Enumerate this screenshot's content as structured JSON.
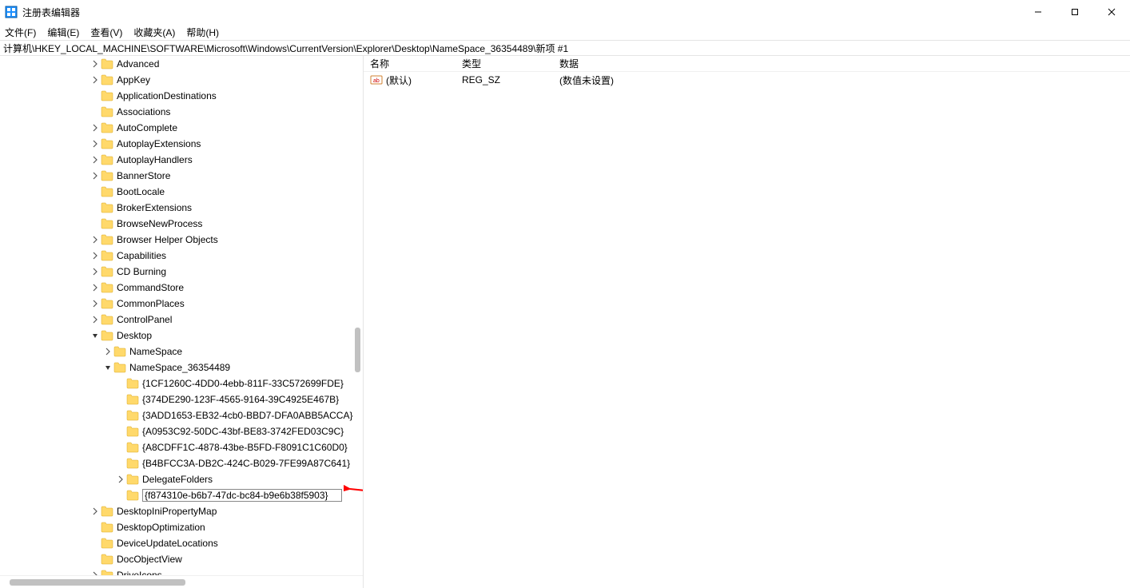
{
  "title": "注册表编辑器",
  "menu": {
    "file": "文件(F)",
    "edit": "编辑(E)",
    "view": "查看(V)",
    "fav": "收藏夹(A)",
    "help": "帮助(H)"
  },
  "address": "计算机\\HKEY_LOCAL_MACHINE\\SOFTWARE\\Microsoft\\Windows\\CurrentVersion\\Explorer\\Desktop\\NameSpace_36354489\\新项 #1",
  "tree": [
    {
      "d": 6,
      "c": "r",
      "name": "Advanced"
    },
    {
      "d": 6,
      "c": "r",
      "name": "AppKey"
    },
    {
      "d": 6,
      "c": "",
      "name": "ApplicationDestinations"
    },
    {
      "d": 6,
      "c": "",
      "name": "Associations"
    },
    {
      "d": 6,
      "c": "r",
      "name": "AutoComplete"
    },
    {
      "d": 6,
      "c": "r",
      "name": "AutoplayExtensions"
    },
    {
      "d": 6,
      "c": "r",
      "name": "AutoplayHandlers"
    },
    {
      "d": 6,
      "c": "r",
      "name": "BannerStore"
    },
    {
      "d": 6,
      "c": "",
      "name": "BootLocale"
    },
    {
      "d": 6,
      "c": "",
      "name": "BrokerExtensions"
    },
    {
      "d": 6,
      "c": "",
      "name": "BrowseNewProcess"
    },
    {
      "d": 6,
      "c": "r",
      "name": "Browser Helper Objects"
    },
    {
      "d": 6,
      "c": "r",
      "name": "Capabilities"
    },
    {
      "d": 6,
      "c": "r",
      "name": "CD Burning"
    },
    {
      "d": 6,
      "c": "r",
      "name": "CommandStore"
    },
    {
      "d": 6,
      "c": "r",
      "name": "CommonPlaces"
    },
    {
      "d": 6,
      "c": "r",
      "name": "ControlPanel"
    },
    {
      "d": 6,
      "c": "d",
      "name": "Desktop"
    },
    {
      "d": 7,
      "c": "r",
      "name": "NameSpace"
    },
    {
      "d": 7,
      "c": "d",
      "name": "NameSpace_36354489"
    },
    {
      "d": 8,
      "c": "",
      "name": "{1CF1260C-4DD0-4ebb-811F-33C572699FDE}"
    },
    {
      "d": 8,
      "c": "",
      "name": "{374DE290-123F-4565-9164-39C4925E467B}"
    },
    {
      "d": 8,
      "c": "",
      "name": "{3ADD1653-EB32-4cb0-BBD7-DFA0ABB5ACCA}"
    },
    {
      "d": 8,
      "c": "",
      "name": "{A0953C92-50DC-43bf-BE83-3742FED03C9C}"
    },
    {
      "d": 8,
      "c": "",
      "name": "{A8CDFF1C-4878-43be-B5FD-F8091C1C60D0}"
    },
    {
      "d": 8,
      "c": "",
      "name": "{B4BFCC3A-DB2C-424C-B029-7FE99A87C641}"
    },
    {
      "d": 8,
      "c": "r",
      "name": "DelegateFolders"
    },
    {
      "d": 8,
      "c": "",
      "edit": true,
      "name": "{f874310e-b6b7-47dc-bc84-b9e6b38f5903}"
    },
    {
      "d": 6,
      "c": "r",
      "name": "DesktopIniPropertyMap"
    },
    {
      "d": 6,
      "c": "",
      "name": "DesktopOptimization"
    },
    {
      "d": 6,
      "c": "",
      "name": "DeviceUpdateLocations"
    },
    {
      "d": 6,
      "c": "",
      "name": "DocObjectView"
    },
    {
      "d": 6,
      "c": "r",
      "name": "DriveIcons"
    }
  ],
  "columns": {
    "name": "名称",
    "type": "类型",
    "data": "数据"
  },
  "values": [
    {
      "name": "(默认)",
      "type": "REG_SZ",
      "data": "(数值未设置)"
    }
  ]
}
